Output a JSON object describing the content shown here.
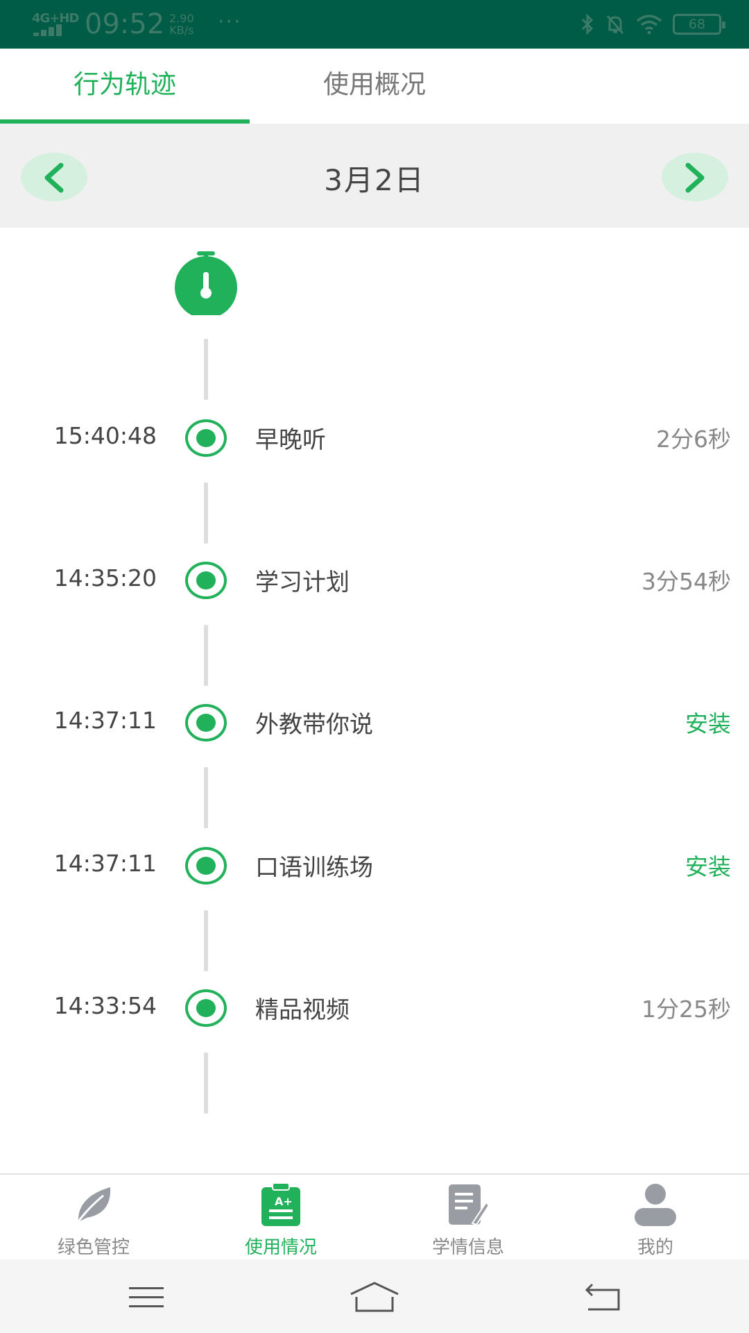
{
  "status_bar": {
    "network": "4G+HD",
    "time": "09:52",
    "speed_value": "2.90",
    "speed_unit": "KB/s",
    "more": "···",
    "battery": "68"
  },
  "tabs": [
    {
      "label": "行为轨迹",
      "active": true
    },
    {
      "label": "使用概况",
      "active": false
    }
  ],
  "date_nav": {
    "date": "3月2日",
    "prev_icon": "chevron-left-icon",
    "next_icon": "chevron-right-icon"
  },
  "timeline": {
    "start_icon": "stopwatch-icon",
    "entries": [
      {
        "time": "15:40:48",
        "app": "早晚听",
        "duration": "2分6秒",
        "is_install": false
      },
      {
        "time": "14:35:20",
        "app": "学习计划",
        "duration": "3分54秒",
        "is_install": false
      },
      {
        "time": "14:37:11",
        "app": "外教带你说",
        "duration": "安装",
        "is_install": true
      },
      {
        "time": "14:37:11",
        "app": "口语训练场",
        "duration": "安装",
        "is_install": true
      },
      {
        "time": "14:33:54",
        "app": "精品视频",
        "duration": "1分25秒",
        "is_install": false
      }
    ]
  },
  "bottom_nav": [
    {
      "label": "绿色管控",
      "icon": "leaf-icon",
      "active": false
    },
    {
      "label": "使用情况",
      "icon": "report-card-icon",
      "active": true
    },
    {
      "label": "学情信息",
      "icon": "document-edit-icon",
      "active": false
    },
    {
      "label": "我的",
      "icon": "person-icon",
      "active": false
    }
  ],
  "system_nav": [
    "menu-icon",
    "home-icon",
    "back-icon"
  ],
  "colors": {
    "accent": "#20b15a",
    "status_bar": "#005c46",
    "inactive_icon": "#9a9ca3"
  }
}
